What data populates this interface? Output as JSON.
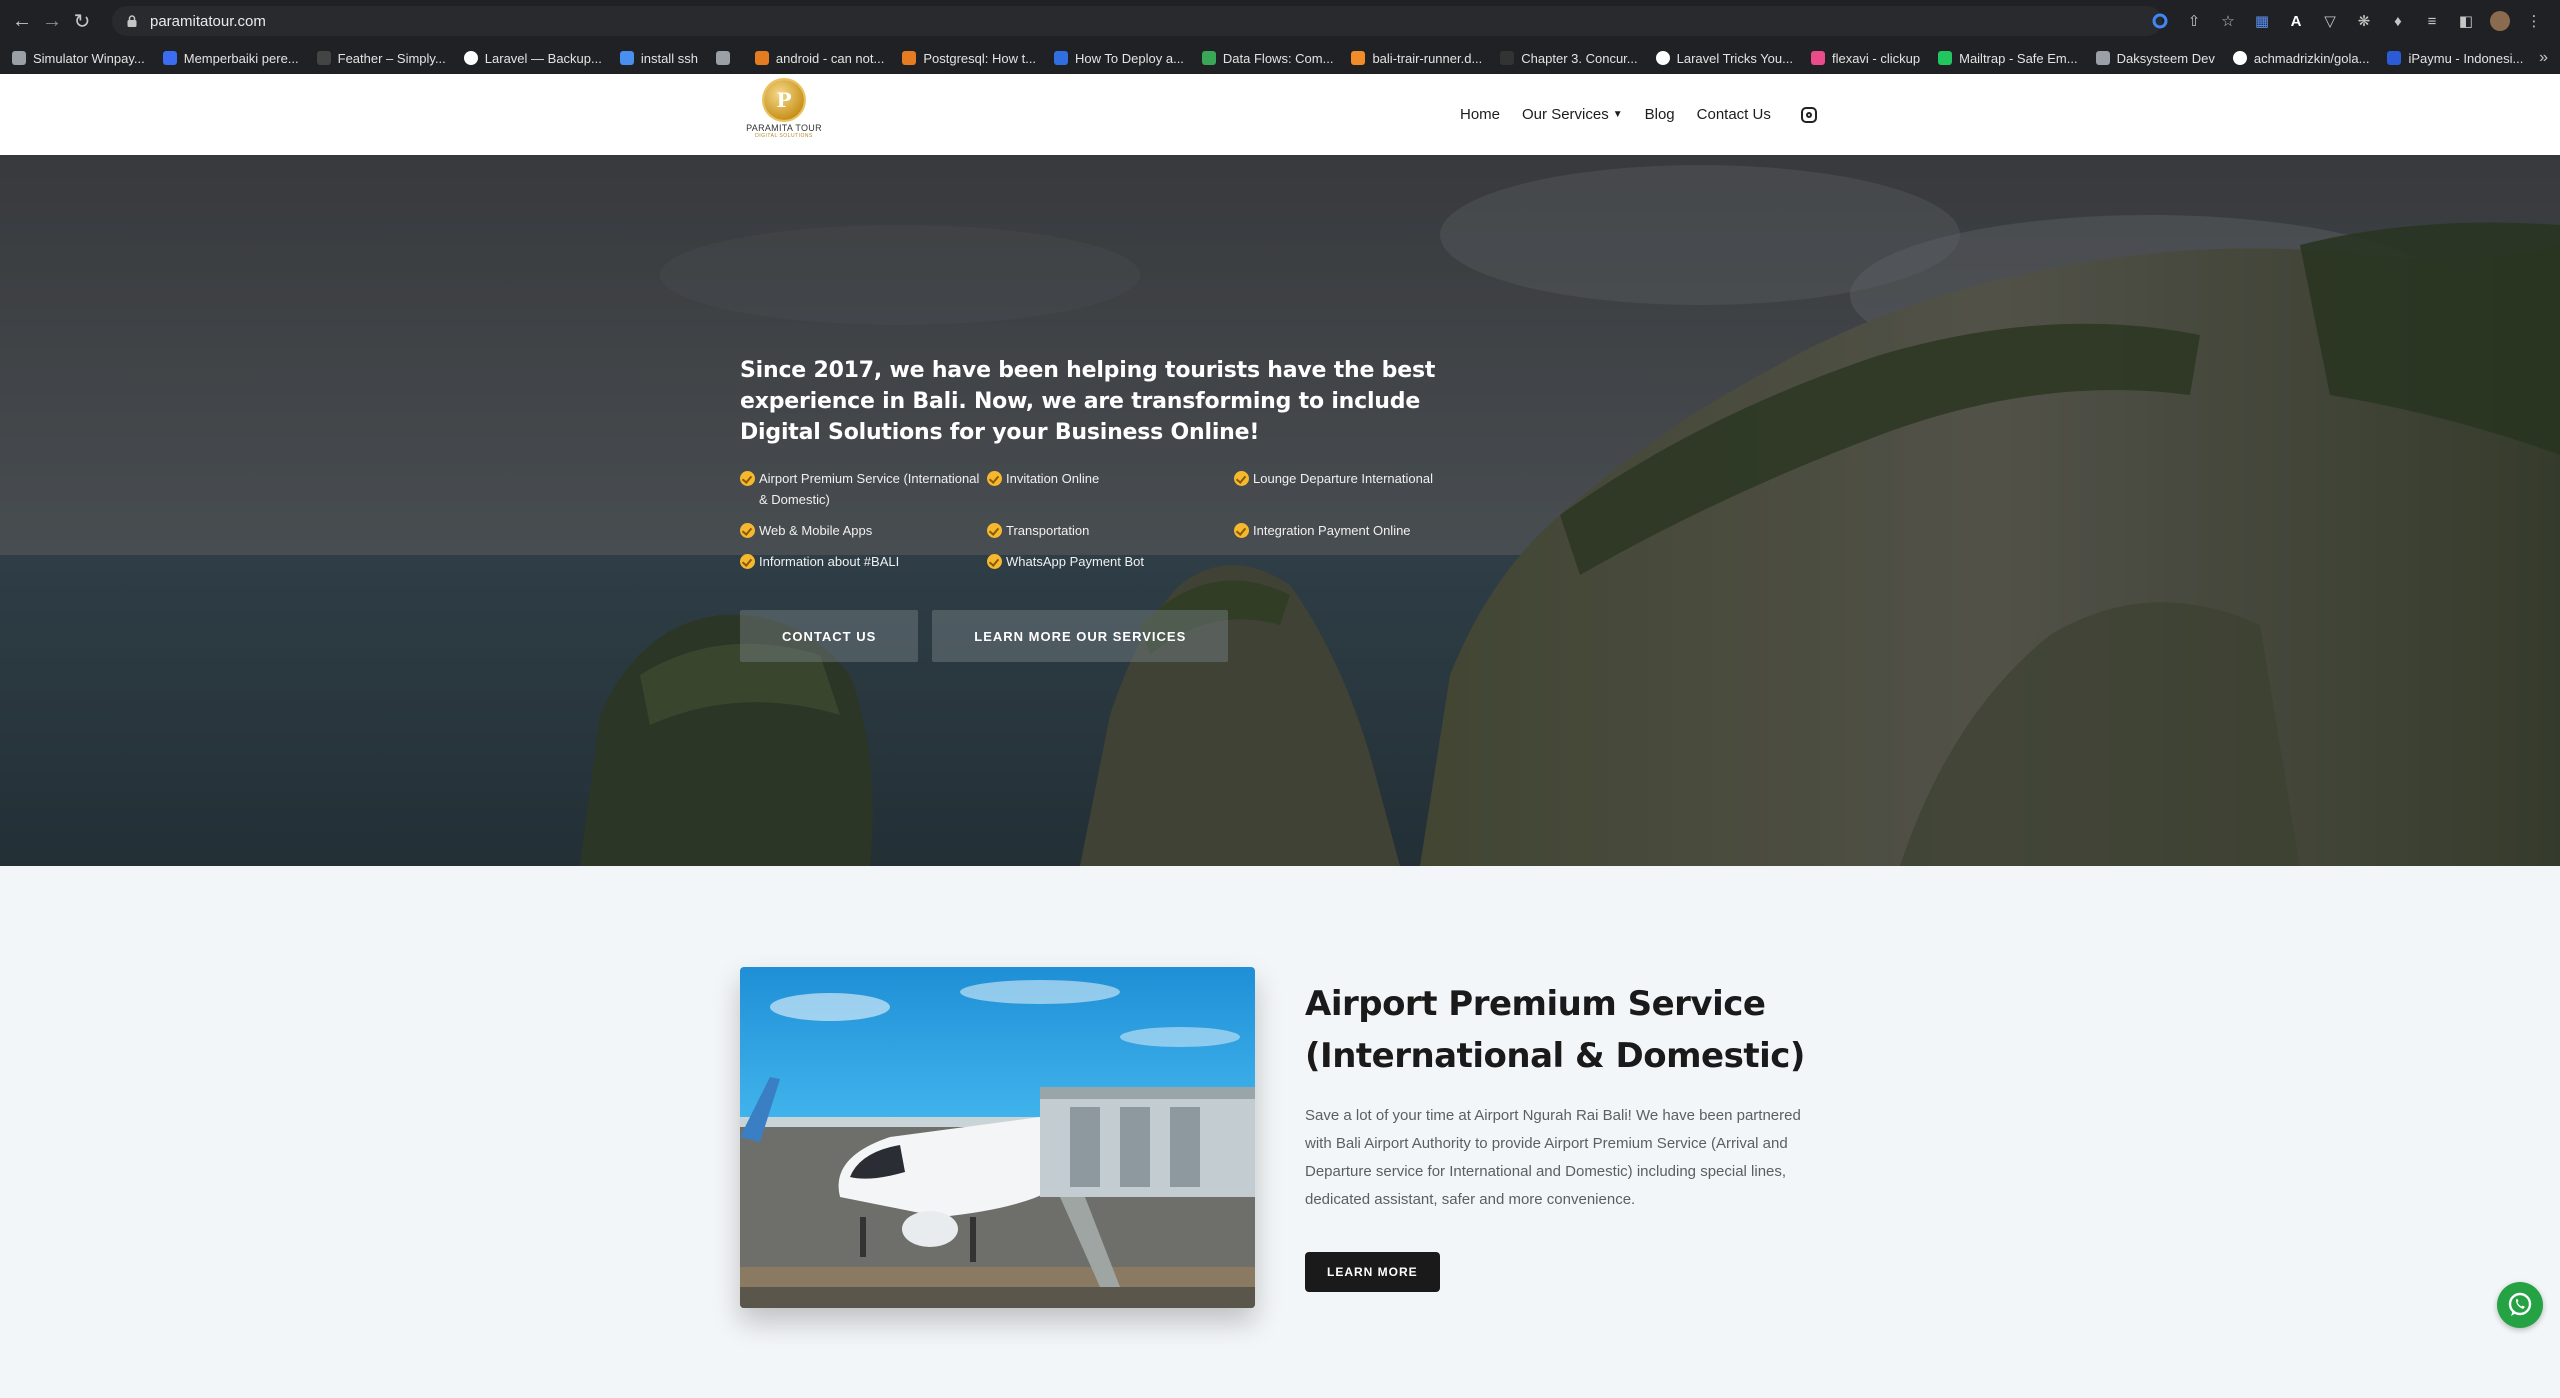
{
  "browser": {
    "url": "paramitatour.com",
    "bookmarks": [
      {
        "label": "Simulator Winpay...",
        "color": "#9aa0a6"
      },
      {
        "label": "Memperbaiki pere...",
        "color": "#3c6df0"
      },
      {
        "label": "Feather – Simply...",
        "color": "#444"
      },
      {
        "label": "Laravel — Backup...",
        "color": "#ffffff"
      },
      {
        "label": "install ssh",
        "color": "#4a8ef0"
      },
      {
        "label": "",
        "color": "#9aa0a6"
      },
      {
        "label": "android - can not...",
        "color": "#e67c22"
      },
      {
        "label": "Postgresql: How t...",
        "color": "#e67c22"
      },
      {
        "label": "How To Deploy a...",
        "color": "#2f6fe0"
      },
      {
        "label": "Data Flows: Com...",
        "color": "#3aa757"
      },
      {
        "label": "bali-trair-runner.d...",
        "color": "#f28c28"
      },
      {
        "label": "Chapter 3. Concur...",
        "color": "#333"
      },
      {
        "label": "Laravel Tricks You...",
        "color": "#ffffff"
      },
      {
        "label": "flexavi - clickup",
        "color": "#e94c8b"
      },
      {
        "label": "Mailtrap - Safe Em...",
        "color": "#22c55e"
      },
      {
        "label": "Daksysteem Dev",
        "color": "#9aa0a6"
      },
      {
        "label": "achmadrizkin/gola...",
        "color": "#ffffff"
      },
      {
        "label": "iPaymu - Indonesi...",
        "color": "#2b5cd6"
      }
    ]
  },
  "header": {
    "logo_name": "PARAMITA TOUR",
    "logo_sub": "DIGITAL SOLUTIONS",
    "nav": {
      "home": "Home",
      "services": "Our Services",
      "blog": "Blog",
      "contact": "Contact Us"
    }
  },
  "hero": {
    "title": "Since 2017, we have been helping tourists have the best experience in Bali. Now, we are transforming to include Digital Solutions for your Business Online!",
    "features": [
      "Airport Premium Service (International & Domestic)",
      "Invitation Online",
      "Lounge Departure International",
      "Web & Mobile Apps",
      "Transportation",
      "Integration Payment Online",
      "Information about #BALI",
      "WhatsApp Payment Bot"
    ],
    "buttons": {
      "contact": "CONTACT US",
      "learn": "LEARN MORE OUR SERVICES"
    }
  },
  "service": {
    "title": "Airport Premium Service (International & Domestic)",
    "description": "Save a lot of your time at Airport Ngurah Rai Bali! We have been partnered with Bali Airport Authority to provide Airport Premium Service (Arrival and Departure service for International and Domestic) including special lines, dedicated assistant, safer and more convenience.",
    "button": "LEARN MORE"
  },
  "colors": {
    "accent_gold": "#c9941f",
    "whatsapp": "#25a244",
    "dark_button": "#1a1a1a"
  }
}
